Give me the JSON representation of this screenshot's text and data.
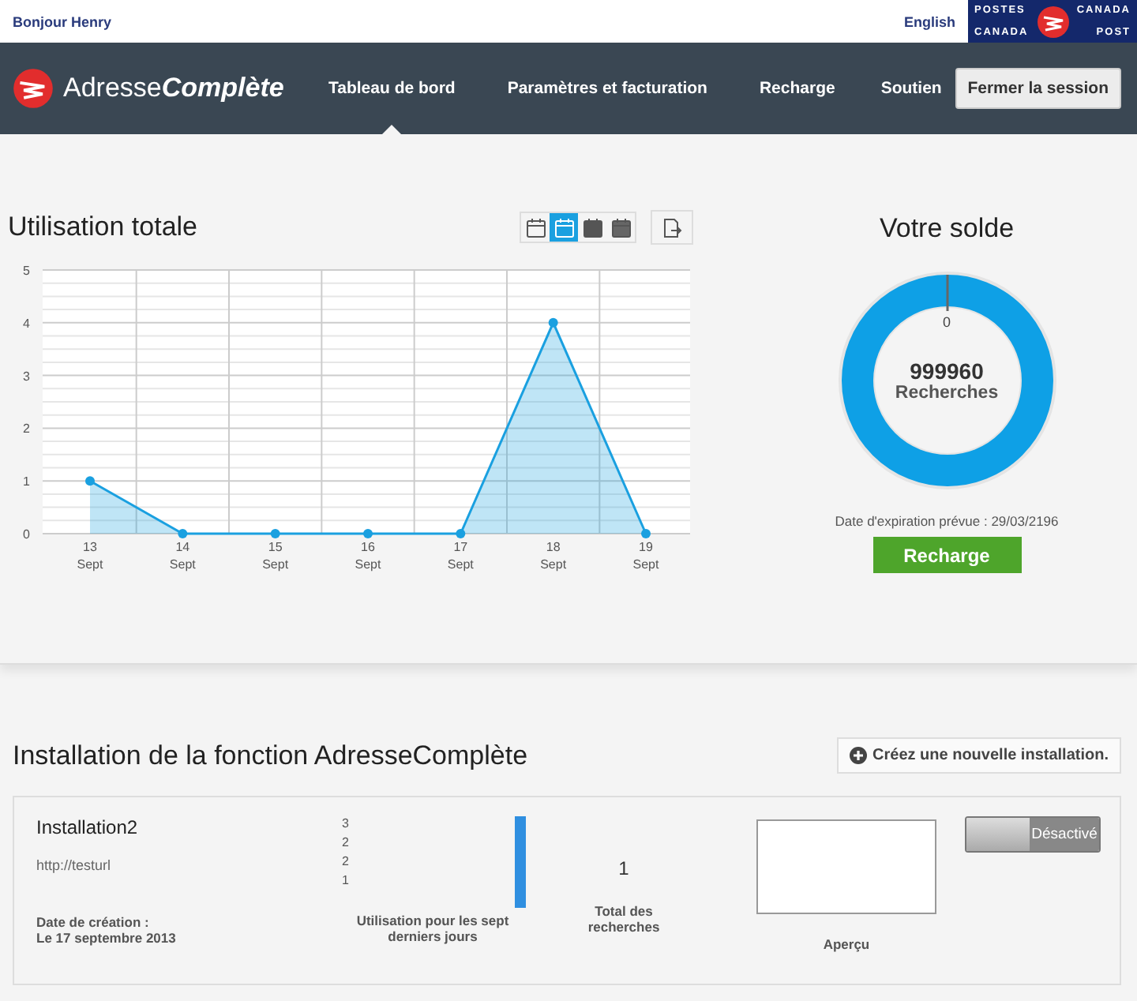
{
  "top_bar": {
    "greeting": "Bonjour Henry",
    "language_link": "English",
    "post_logo": [
      "POSTES",
      "CANADA",
      "CANADA",
      "POST"
    ]
  },
  "nav": {
    "brand": {
      "plain": "Adresse",
      "bold": "Complète"
    },
    "items": [
      {
        "label": "Tableau de bord",
        "selected": true
      },
      {
        "label": "Paramètres et facturation",
        "selected": false
      },
      {
        "label": "Recharge",
        "selected": false
      },
      {
        "label": "Soutien",
        "selected": false
      }
    ],
    "logout": "Fermer la session"
  },
  "usage": {
    "title": "Utilisation totale",
    "views": [
      {
        "kind": "day",
        "selected": false
      },
      {
        "kind": "week",
        "selected": true
      },
      {
        "kind": "month",
        "selected": false
      },
      {
        "kind": "year",
        "selected": false
      }
    ],
    "chart_data": {
      "type": "area",
      "categories": [
        "13 Sept",
        "14 Sept",
        "15 Sept",
        "16 Sept",
        "17 Sept",
        "18 Sept",
        "19 Sept"
      ],
      "series": [
        {
          "color": "#1aa0e0",
          "values": [
            1,
            0,
            0,
            0,
            0,
            4,
            0
          ]
        }
      ],
      "grid": true,
      "ylim": [
        0,
        5
      ],
      "yticks": [
        {
          "value": 0,
          "label": "0"
        },
        {
          "value": 1,
          "label": "1"
        },
        {
          "value": 2,
          "label": "2"
        },
        {
          "value": 3,
          "label": "3"
        },
        {
          "value": 4,
          "label": "4"
        },
        {
          "value": 5,
          "label": "5"
        }
      ]
    }
  },
  "balance": {
    "title": "Votre solde",
    "marker": "0",
    "amount": "999960",
    "unit": "Recherches",
    "expiry": "Date d'expiration prévue : 29/03/2196",
    "recharge": "Recharge"
  },
  "installations": {
    "title": "Installation de la fonction AdresseComplète",
    "create": "Créez une nouvelle installation.",
    "items": [
      {
        "name": "Installation2",
        "url": "http://testurl",
        "created_label": "Date de création :",
        "created": "Le 17 septembre 2013",
        "axis_labels": [
          "3",
          "2",
          "2",
          "1"
        ],
        "usage_label": "Utilisation pour les sept derniers jours",
        "total": "1",
        "total_label": "Total des recherches",
        "preview_label": "Aperçu",
        "toggle": {
          "label": "Désactivé",
          "on": false
        }
      }
    ]
  }
}
